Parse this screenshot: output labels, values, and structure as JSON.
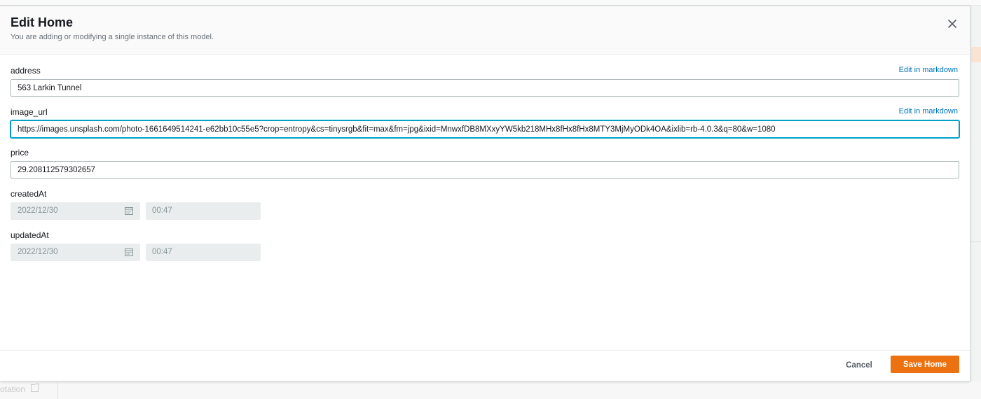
{
  "modal": {
    "title": "Edit Home",
    "subtitle": "You are adding or modifying a single instance of this model."
  },
  "fields": {
    "address": {
      "label": "address",
      "value": "563 Larkin Tunnel",
      "markdown_link": "Edit in markdown"
    },
    "image_url": {
      "label": "image_url",
      "value": "https://images.unsplash.com/photo-1661649514241-e62bb10c55e5?crop=entropy&cs=tinysrgb&fit=max&fm=jpg&ixid=MnwxfDB8MXxyYW5kb218MHx8fHx8fHx8MTY3MjMyODk4OA&ixlib=rb-4.0.3&q=80&w=1080",
      "markdown_link": "Edit in markdown"
    },
    "price": {
      "label": "price",
      "value": "29.208112579302657"
    },
    "createdAt": {
      "label": "createdAt",
      "date": "2022/12/30",
      "time": "00:47"
    },
    "updatedAt": {
      "label": "updatedAt",
      "date": "2022/12/30",
      "time": "00:47"
    }
  },
  "footer": {
    "cancel_label": "Cancel",
    "save_label": "Save Home"
  },
  "background": {
    "footer_text": "otation"
  },
  "colors": {
    "primary_button": "#ec7211",
    "link": "#0073bb",
    "focus": "#00a1c9"
  }
}
